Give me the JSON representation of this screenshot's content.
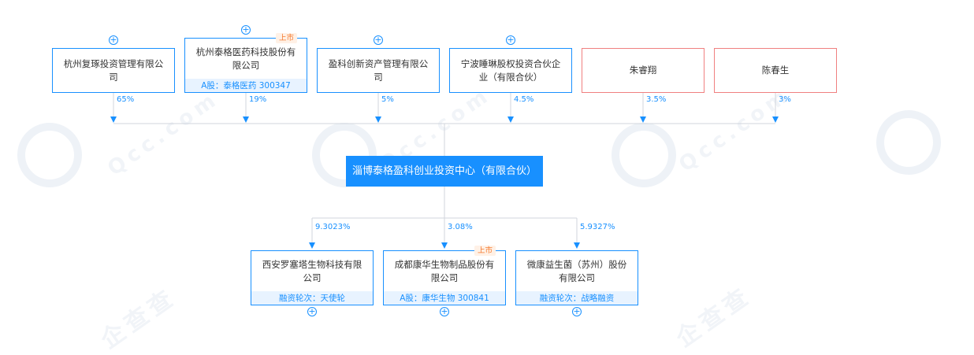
{
  "colors": {
    "accent": "#1890ff",
    "person_border": "#f08080",
    "line": "#d0d5dc",
    "listed_tag_bg": "#fff1e6",
    "listed_tag_text": "#f57c32",
    "footer_bg": "#e8f3ff"
  },
  "watermark": {
    "text": "企查查",
    "domain": "Qcc.com"
  },
  "center": {
    "name": "淄博泰格盈科创业投资中心（有限合伙）"
  },
  "shareholders": [
    {
      "name": "杭州复琢投资管理有限公司",
      "percent": "65%",
      "type": "company",
      "expand_icon": "plus-circle-icon"
    },
    {
      "name": "杭州泰格医药科技股份有限公司",
      "percent": "19%",
      "type": "company",
      "tag": "上市",
      "footer": "A股：泰格医药 300347",
      "expand_icon": "plus-circle-icon"
    },
    {
      "name": "盈科创新资产管理有限公司",
      "percent": "5%",
      "type": "company",
      "expand_icon": "plus-circle-icon"
    },
    {
      "name": "宁波睡琳股权投资合伙企业（有限合伙）",
      "percent": "4.5%",
      "type": "company",
      "expand_icon": "plus-circle-icon"
    },
    {
      "name": "朱睿翔",
      "percent": "3.5%",
      "type": "person"
    },
    {
      "name": "陈春生",
      "percent": "3%",
      "type": "person"
    }
  ],
  "investments": [
    {
      "name": "西安罗塞塔生物科技有限公司",
      "percent": "9.3023%",
      "footer": "融资轮次：天使轮",
      "expand_icon": "plus-circle-icon"
    },
    {
      "name": "成都康华生物制品股份有限公司",
      "percent": "3.08%",
      "tag": "上市",
      "footer": "A股：康华生物 300841",
      "expand_icon": "plus-circle-icon"
    },
    {
      "name": "微康益生菌（苏州）股份有限公司",
      "percent": "5.9327%",
      "footer": "融资轮次：战略融资",
      "expand_icon": "plus-circle-icon"
    }
  ]
}
